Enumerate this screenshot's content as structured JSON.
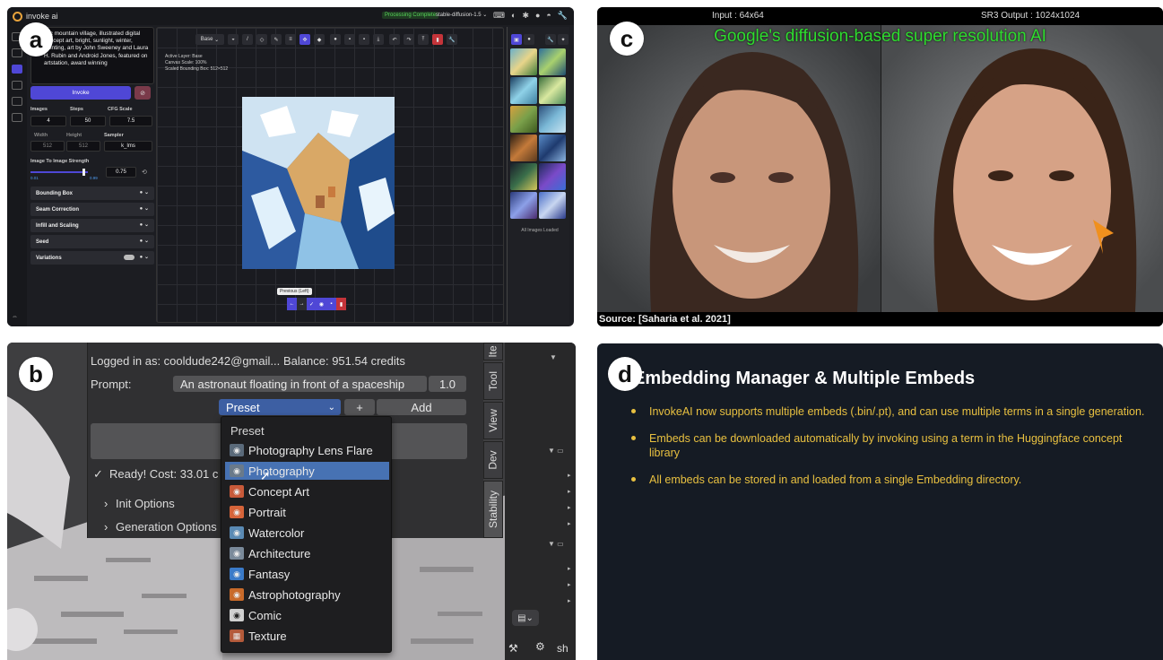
{
  "badges": {
    "a": "a",
    "b": "b",
    "c": "c",
    "d": "d"
  },
  "panel_a": {
    "app_name": "invoke ai",
    "status": "Processing Complete",
    "model": "stable-diffusion-1.5",
    "model_caret": "⌄",
    "prompt": "...ic mountain village, illustrated digital concept art, bright, sunlight, winter, painting, art by John Sweeney and Laura H. Rubin and Android Jones, featured on artstation, award winning",
    "invoke_label": "Invoke",
    "cancel_label": "⊘",
    "labels": {
      "images": "Images",
      "steps": "Steps",
      "cfg": "CFG Scale",
      "width": "Width",
      "height": "Height",
      "sampler": "Sampler",
      "strength": "Image To Image Strength"
    },
    "values": {
      "images": "4",
      "steps": "50",
      "cfg": "7.5",
      "width": "512",
      "height": "512",
      "sampler": "k_lms",
      "strength": "0.75",
      "min": "0.01",
      "max": "0.99"
    },
    "sections": [
      "Bounding Box",
      "Seam Correction",
      "Infill and Scaling",
      "Seed",
      "Variations"
    ],
    "toolbar": {
      "layer": "Base"
    },
    "canvas_info": [
      "Active Layer: Base",
      "Canvas Scale: 100%",
      "Scaled Bounding Box: 512×512"
    ],
    "tooltip": "Previous (Left)",
    "all_loaded": "All Images Loaded",
    "colors": {
      "accent": "#4f47d6",
      "danger": "#c4343a",
      "ok": "#58d35a"
    }
  },
  "panel_b": {
    "logged_in": "Logged in as: cooldude242@gmail...",
    "balance": "Balance: 951.54 credits",
    "prompt_label": "Prompt:",
    "prompt_value": "An astronaut floating in front of a spaceship",
    "weight": "1.0",
    "preset_value": "Preset",
    "plus": "+",
    "add": "Add",
    "ready": "Ready! Cost: 33.01 c",
    "init_options": "Init Options",
    "generation_options": "Generation Options",
    "dropdown_header": "Preset",
    "dropdown": [
      "Photography Lens Flare",
      "Photography",
      "Concept Art",
      "Portrait",
      "Watercolor",
      "Architecture",
      "Fantasy",
      "Astrophotography",
      "Comic",
      "Texture"
    ],
    "tabs": [
      "Ite",
      "Tool",
      "View",
      "Dev",
      "Stability"
    ],
    "outliner_text": "sh"
  },
  "panel_c": {
    "input_label": "Input : 64x64",
    "output_label": "SR3 Output : 1024x1024",
    "title": "Google's diffusion-based super resolution AI",
    "source": "Source: [Saharia et al. 2021]"
  },
  "panel_d": {
    "title": "Embedding Manager & Multiple Embeds",
    "bullets": [
      "InvokeAI now supports multiple embeds (.bin/.pt), and can use multiple terms in a single generation.",
      "Embeds can be downloaded automatically by invoking using a term in the Huggingface concept library",
      "All embeds can be stored in and loaded from a single Embedding directory."
    ]
  }
}
